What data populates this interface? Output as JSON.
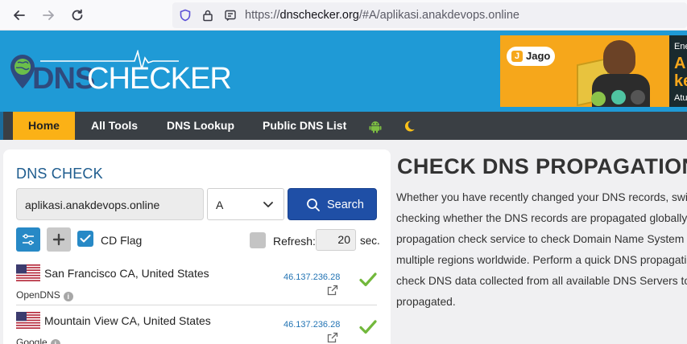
{
  "browser": {
    "url_prefix": "https://",
    "url_domain": "dnschecker.org",
    "url_path": "/#A/aplikasi.anakdevops.online"
  },
  "header": {
    "logo": {
      "part1": "DNS",
      "part2": "CHECKER"
    },
    "ad": {
      "brand": "Jago",
      "text_lines": [
        "Ene",
        "A",
        "ke",
        "Atu"
      ]
    }
  },
  "menu": {
    "items": [
      "Home",
      "All Tools",
      "DNS Lookup",
      "Public DNS List"
    ],
    "icons": [
      "android-icon",
      "moon-icon"
    ],
    "active_color": "#fbb116"
  },
  "dns_check": {
    "title": "DNS CHECK",
    "domain_value": "aplikasi.anakdevops.online",
    "record_type": "A",
    "search_label": "Search",
    "cd_flag_label": "CD Flag",
    "cd_flag_checked": true,
    "refresh_label": "Refresh:",
    "refresh_checked": false,
    "refresh_value": "20",
    "refresh_unit": "sec."
  },
  "servers": [
    {
      "location": "San Francisco CA, United States",
      "provider": "OpenDNS",
      "ip": "46.137.236.28",
      "status": "ok"
    },
    {
      "location": "Mountain View CA, United States",
      "provider": "Google",
      "ip": "46.137.236.28",
      "status": "ok"
    }
  ],
  "main": {
    "title": "CHECK DNS PROPAGATION",
    "description_lines": [
      "Whether you have recently changed your DNS records, swit",
      "checking whether the DNS records are propagated globally",
      "propagation check service to check Domain Name System r",
      "multiple regions worldwide. Perform a quick DNS propagati",
      "check DNS data collected from all available DNS Servers to c",
      "propagated."
    ]
  },
  "colors": {
    "header_blue": "#1f9ad6",
    "menu_dark": "#3a3f44",
    "search_blue": "#1f4fa6",
    "tick_green": "#72b83c"
  }
}
